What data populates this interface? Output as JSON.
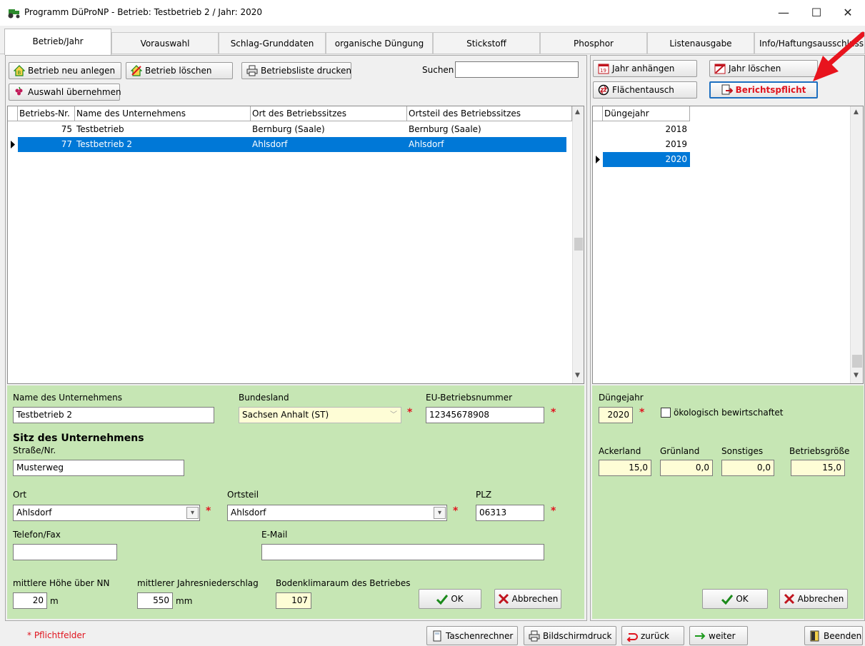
{
  "window": {
    "title": "Programm DüProNP - Betrieb: Testbetrieb 2 / Jahr: 2020"
  },
  "tabs": [
    {
      "label": "Betrieb/Jahr",
      "active": true
    },
    {
      "label": "Vorauswahl"
    },
    {
      "label": "Schlag-Grunddaten"
    },
    {
      "label": "organische Düngung"
    },
    {
      "label": "Stickstoff"
    },
    {
      "label": "Phosphor"
    },
    {
      "label": "Listenausgabe"
    },
    {
      "label": "Info/Haftungsausschluss"
    }
  ],
  "left_toolbar": {
    "new_label": "Betrieb neu anlegen",
    "delete_label": "Betrieb löschen",
    "print_label": "Betriebsliste drucken",
    "search_label": "Suchen",
    "search_value": "",
    "select_label": "Auswahl übernehmen"
  },
  "betrieb_table": {
    "columns": [
      "Betriebs-Nr.",
      "Name des Unternehmens",
      "Ort des Betriebssitzes",
      "Ortsteil des Betriebssitzes"
    ],
    "rows": [
      {
        "nr": "75",
        "name": "Testbetrieb",
        "ort": "Bernburg (Saale)",
        "ortsteil": "Bernburg (Saale)",
        "selected": false
      },
      {
        "nr": "77",
        "name": "Testbetrieb 2",
        "ort": "Ahlsdorf",
        "ortsteil": "Ahlsdorf",
        "selected": true
      }
    ]
  },
  "right_toolbar": {
    "append_year_label": "Jahr anhängen",
    "delete_year_label": "Jahr löschen",
    "swap_label": "Flächentausch",
    "report_label": "Berichtspflicht"
  },
  "year_table": {
    "column": "Düngejahr",
    "rows": [
      {
        "year": "2018",
        "selected": false
      },
      {
        "year": "2019",
        "selected": false
      },
      {
        "year": "2020",
        "selected": true
      }
    ]
  },
  "betrieb_form": {
    "name_label": "Name des Unternehmens",
    "name_value": "Testbetrieb 2",
    "bundesland_label": "Bundesland",
    "bundesland_value": "Sachsen Anhalt (ST)",
    "eu_label": "EU-Betriebsnummer",
    "eu_value": "12345678908",
    "sitz_heading": "Sitz des Unternehmens",
    "strasse_label": "Straße/Nr.",
    "strasse_value": "Musterweg",
    "ort_label": "Ort",
    "ort_value": "Ahlsdorf",
    "ortsteil_label": "Ortsteil",
    "ortsteil_value": "Ahlsdorf",
    "plz_label": "PLZ",
    "plz_value": "06313",
    "telefon_label": "Telefon/Fax",
    "telefon_value": "",
    "email_label": "E-Mail",
    "email_value": "",
    "hoehe_label": "mittlere Höhe über NN",
    "hoehe_value": "20",
    "hoehe_unit": "m",
    "niederschlag_label": "mittlerer Jahresniederschlag",
    "niederschlag_value": "550",
    "niederschlag_unit": "mm",
    "boden_label": "Bodenklimaraum des Betriebes",
    "boden_value": "107",
    "ok_label": "OK",
    "cancel_label": "Abbrechen"
  },
  "year_form": {
    "year_label": "Düngejahr",
    "year_value": "2020",
    "oeko_label": "ökologisch bewirtschaftet",
    "ackerland_label": "Ackerland",
    "ackerland_value": "15,0",
    "gruenland_label": "Grünland",
    "gruenland_value": "0,0",
    "sonstiges_label": "Sonstiges",
    "sonstiges_value": "0,0",
    "groesse_label": "Betriebsgröße",
    "groesse_value": "15,0",
    "ok_label": "OK",
    "cancel_label": "Abbrechen"
  },
  "statusbar": {
    "pflicht_label": "* Pflichtfelder",
    "rechner_label": "Taschenrechner",
    "druck_label": "Bildschirmdruck",
    "zurueck_label": "zurück",
    "weiter_label": "weiter",
    "beenden_label": "Beenden"
  },
  "colors": {
    "accent": "#0078d7",
    "form_bg": "#c6e6b4",
    "required": "#e0141e",
    "readonly_bg": "#fefdd6",
    "annotation_arrow": "#e8141e"
  }
}
